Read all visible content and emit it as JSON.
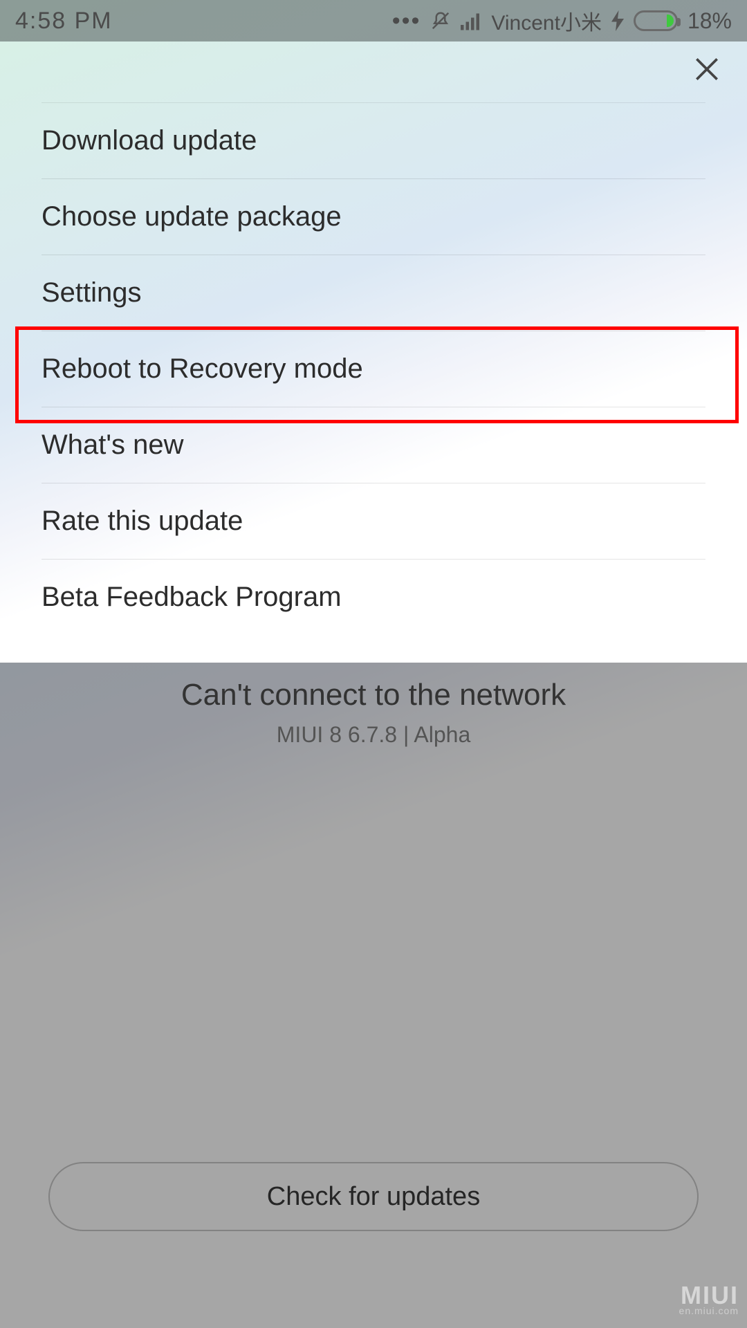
{
  "status_bar": {
    "time": "4:58  PM",
    "carrier": "Vincent小米",
    "battery_pct": "18%",
    "battery_fill_pct": 18
  },
  "menu": {
    "items": [
      "Download update",
      "Choose update package",
      "Settings",
      "Reboot to Recovery mode",
      "What's new",
      "Rate this update",
      "Beta Feedback Program"
    ],
    "highlighted_index": 3
  },
  "background": {
    "message_main": "Can't connect to the network",
    "message_sub": "MIUI 8 6.7.8 | Alpha",
    "check_button": "Check for updates"
  },
  "watermark": {
    "main": "MIUI",
    "sub": "en.miui.com"
  }
}
